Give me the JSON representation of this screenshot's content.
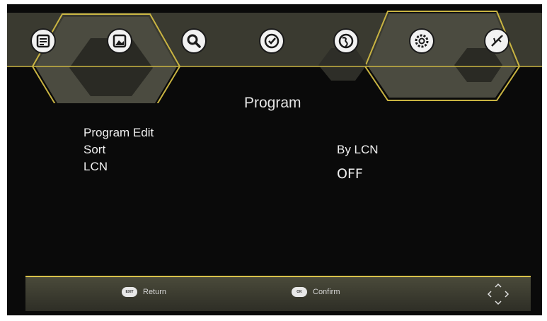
{
  "menu": {
    "title": "Program",
    "items": [
      {
        "label": "Program Edit",
        "value": ""
      },
      {
        "label": "Sort",
        "value": "By LCN"
      },
      {
        "label": "LCN",
        "value": "OFF"
      }
    ]
  },
  "top_icons": [
    "program-icon",
    "picture-icon",
    "search-icon",
    "time-icon",
    "globe-icon",
    "gear-icon",
    "usb-icon"
  ],
  "footer": {
    "return_key": "EXIT",
    "return_label": "Return",
    "confirm_key": "OK",
    "confirm_label": "Confirm"
  },
  "colors": {
    "accent": "#d9c24a",
    "background": "#0a0a0a",
    "icon_face": "#f2f2f2"
  }
}
